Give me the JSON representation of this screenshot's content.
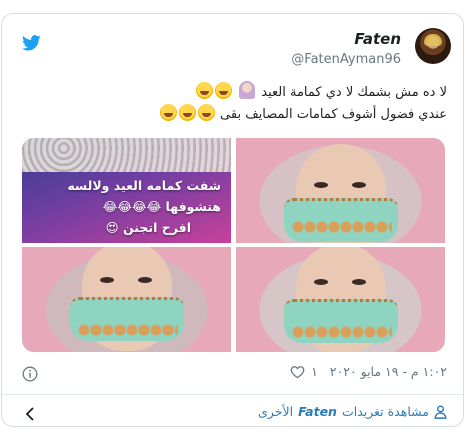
{
  "author": {
    "name": "Faten",
    "handle": "@FatenAyman96"
  },
  "tweet": {
    "line1": "لا ده مش بشمك لا دي كمامة العيد",
    "line2": "عندي فضول أشوف كمامات المصايف بقى"
  },
  "media": {
    "overlay_text": [
      "شفت كمامه العيد ولالسه",
      "هتشوفها 😂😂😂😂",
      "افرح اتجنن 😍"
    ]
  },
  "meta": {
    "likes": "١",
    "timestamp": "١:٠٢ م - ١٩ مايو ٢٠٢٠"
  },
  "footer": {
    "prefix": "مشاهدة تغريدات",
    "name": "Faten",
    "suffix": "الأخرى"
  },
  "colors": {
    "link": "#2b7bb9",
    "twitter_blue": "#1da1f2",
    "muted": "#697882",
    "border": "#d8dde2"
  },
  "icons": [
    "twitter-bird-icon",
    "heart-icon",
    "info-icon",
    "person-icon",
    "chevron-left-icon"
  ]
}
